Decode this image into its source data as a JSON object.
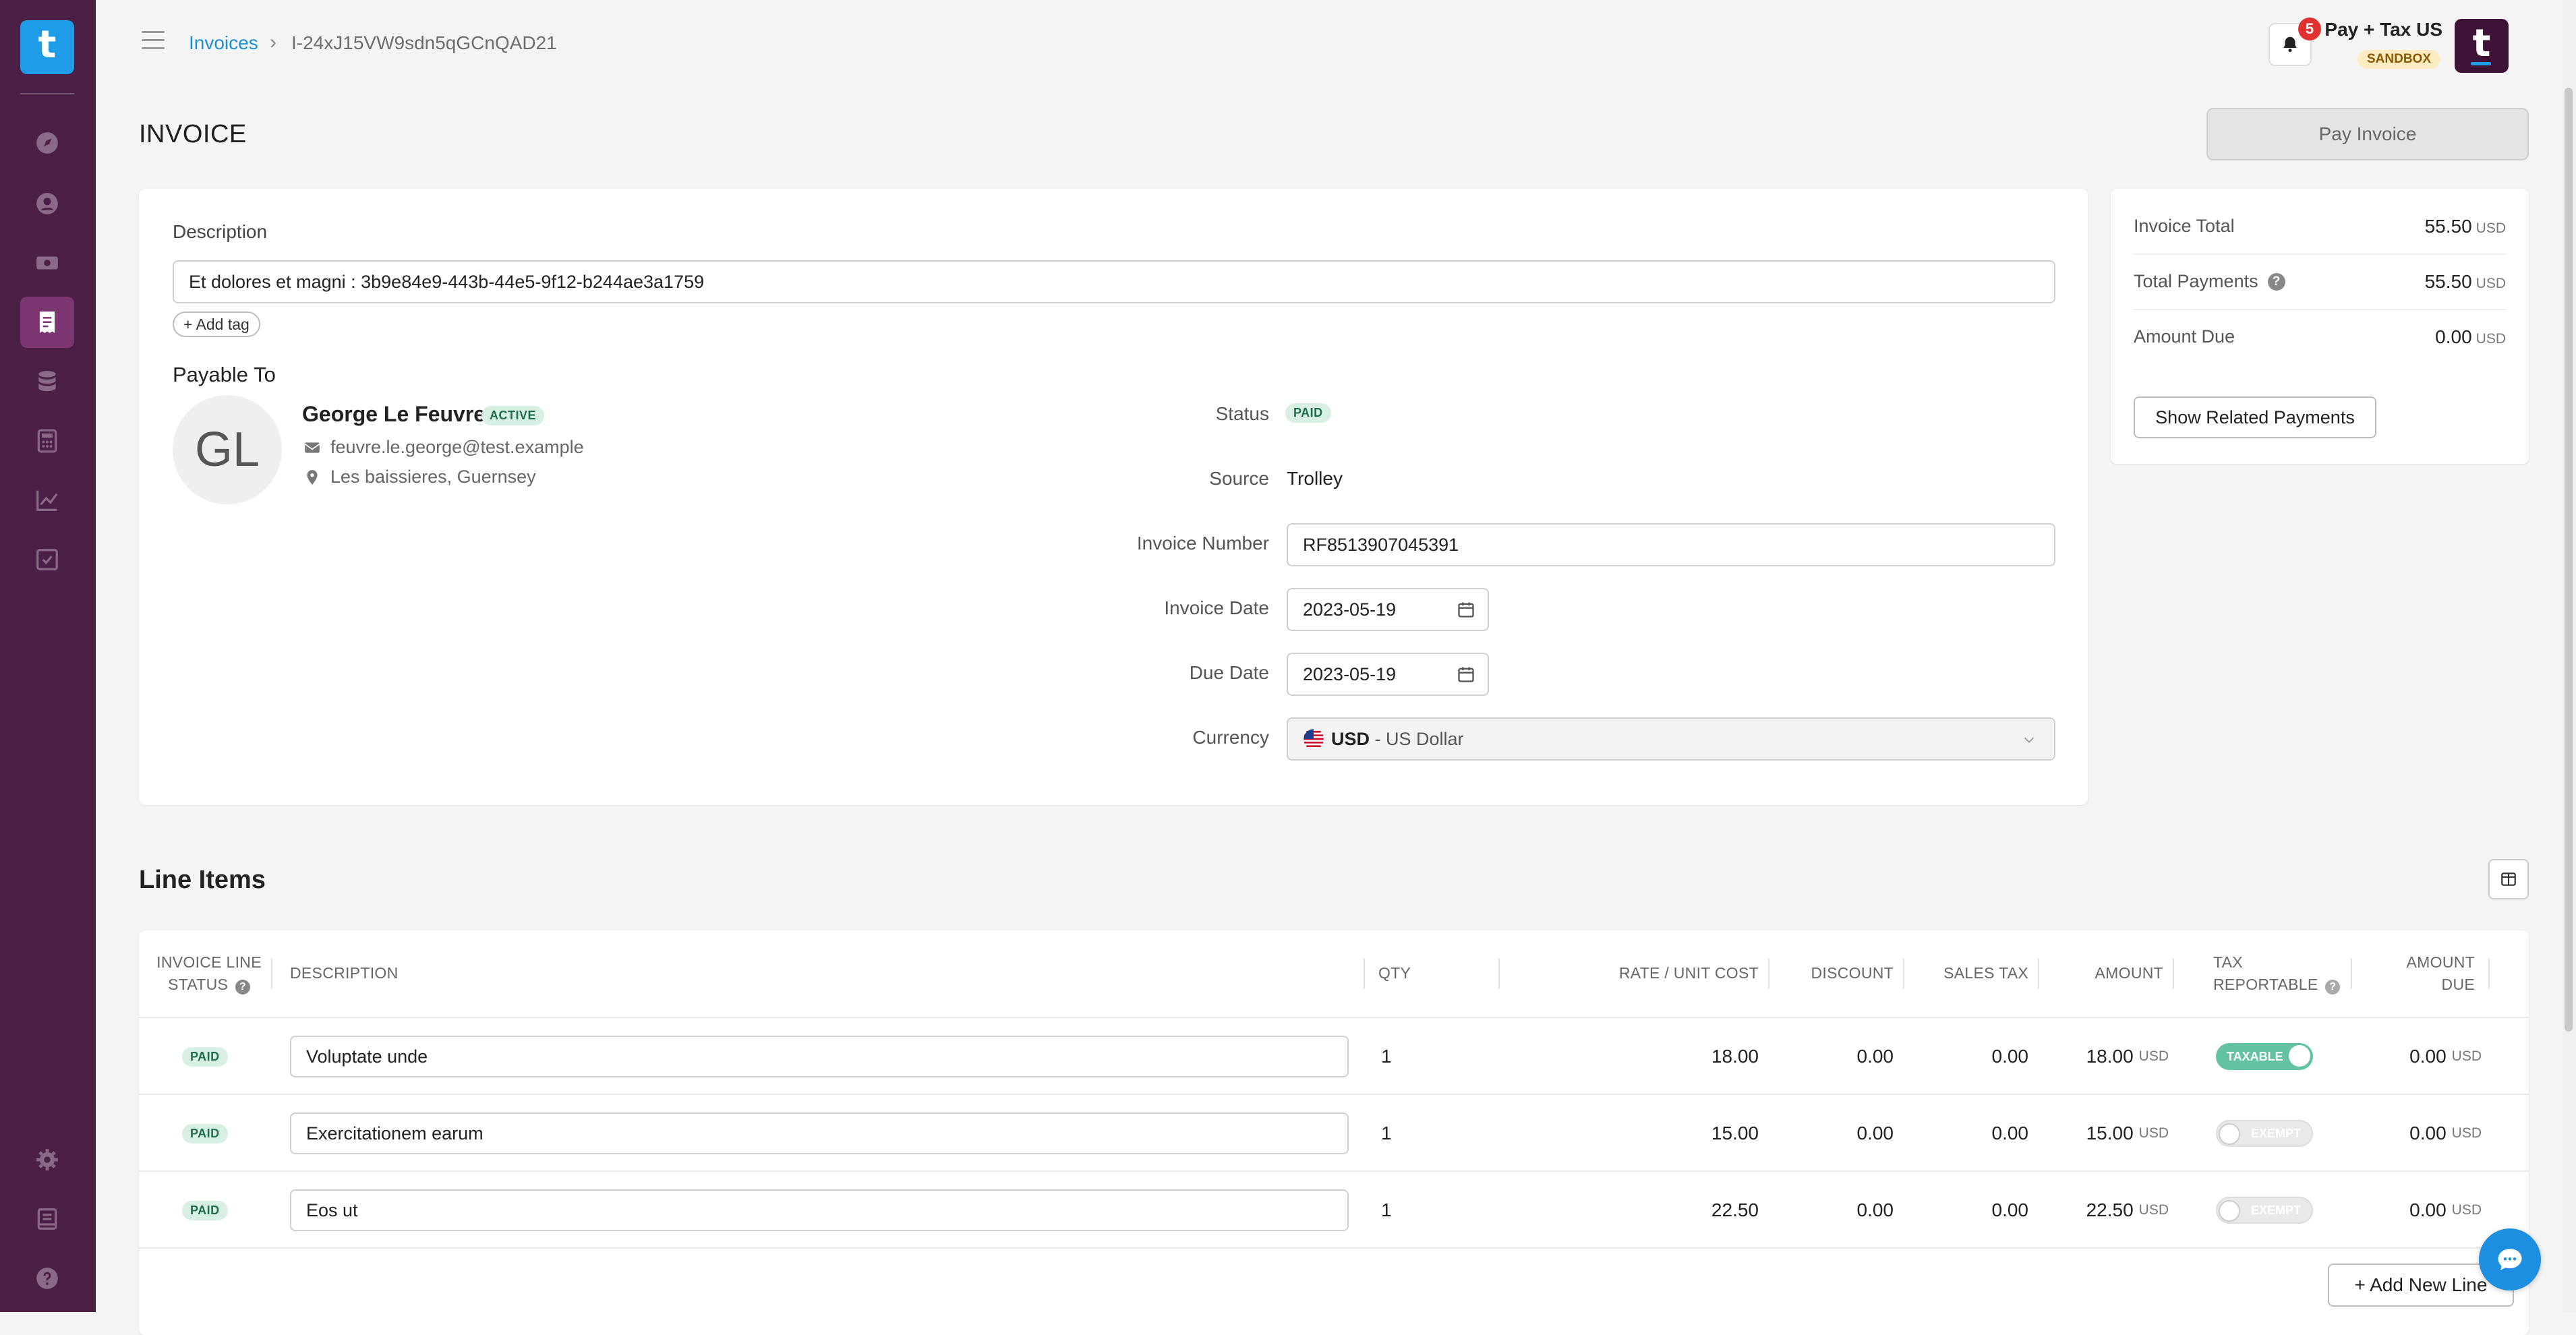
{
  "sidebar": {
    "logo": "t",
    "nav_items": [
      {
        "icon": "dashboard-icon",
        "label": "Dashboard"
      },
      {
        "icon": "person-icon",
        "label": "Recipients"
      },
      {
        "icon": "money-icon",
        "label": "Payments"
      },
      {
        "icon": "invoice-icon",
        "label": "Invoices"
      },
      {
        "icon": "database-icon",
        "label": "Data"
      },
      {
        "icon": "calculator-icon",
        "label": "Tax"
      },
      {
        "icon": "chart-icon",
        "label": "Reports"
      },
      {
        "icon": "checklist-icon",
        "label": "Tasks"
      }
    ],
    "bottom_items": [
      {
        "icon": "gear-icon"
      },
      {
        "icon": "book-icon"
      },
      {
        "icon": "help-icon"
      }
    ]
  },
  "header": {
    "breadcrumb_root": "Invoices",
    "breadcrumb_sep": "›",
    "breadcrumb_current": "I-24xJ15VW9sdn5qGCnQAD21",
    "notification_count": "5",
    "org_name": "Pay + Tax US",
    "env_badge": "SANDBOX",
    "org_logo": "t"
  },
  "page": {
    "title": "INVOICE",
    "pay_button": "Pay Invoice"
  },
  "invoice": {
    "description_label": "Description",
    "description_value": "Et dolores et magni : 3b9e84e9-443b-44e5-9f12-b244ae3a1759",
    "add_tag": "+ Add tag",
    "payable_to_label": "Payable To",
    "payee": {
      "initials": "GL",
      "name": "George Le Feuvre",
      "status": "ACTIVE",
      "email": "feuvre.le.george@test.example",
      "location": "Les baissieres, Guernsey"
    },
    "fields": {
      "status_label": "Status",
      "status_value": "PAID",
      "source_label": "Source",
      "source_value": "Trolley",
      "number_label": "Invoice Number",
      "number_value": "RF8513907045391",
      "invoice_date_label": "Invoice Date",
      "invoice_date_value": "2023-05-19",
      "due_date_label": "Due Date",
      "due_date_value": "2023-05-19",
      "currency_label": "Currency",
      "currency_code": "USD",
      "currency_name": " - US Dollar"
    }
  },
  "summary": {
    "rows": [
      {
        "label": "Invoice Total",
        "value": "55.50",
        "unit": "USD"
      },
      {
        "label": "Total Payments",
        "value": "55.50",
        "unit": "USD"
      },
      {
        "label": "Amount Due",
        "value": "0.00",
        "unit": "USD"
      }
    ],
    "help": "?",
    "related_button": "Show Related Payments"
  },
  "line_items": {
    "title": "Line Items",
    "columns": {
      "status_1": "INVOICE LINE",
      "status_2": "STATUS",
      "description": "DESCRIPTION",
      "qty": "QTY",
      "rate": "RATE / UNIT COST",
      "discount": "DISCOUNT",
      "sales_tax": "SALES TAX",
      "amount": "AMOUNT",
      "tax_1": "TAX",
      "tax_2": "REPORTABLE",
      "due_1": "AMOUNT",
      "due_2": "DUE"
    },
    "rows": [
      {
        "status": "PAID",
        "description": "Voluptate unde",
        "qty": "1",
        "rate": "18.00",
        "discount": "0.00",
        "sales_tax": "0.00",
        "amount": "18.00",
        "unit": "USD",
        "tax": "TAXABLE",
        "tax_on": true,
        "due": "0.00"
      },
      {
        "status": "PAID",
        "description": "Exercitationem earum",
        "qty": "1",
        "rate": "15.00",
        "discount": "0.00",
        "sales_tax": "0.00",
        "amount": "15.00",
        "unit": "USD",
        "tax": "EXEMPT",
        "tax_on": false,
        "due": "0.00"
      },
      {
        "status": "PAID",
        "description": "Eos ut",
        "qty": "1",
        "rate": "22.50",
        "discount": "0.00",
        "sales_tax": "0.00",
        "amount": "22.50",
        "unit": "USD",
        "tax": "EXEMPT",
        "tax_on": false,
        "due": "0.00"
      }
    ],
    "add_button": "+ Add New Line"
  },
  "colors": {
    "sidebar": "#4c2046",
    "accent": "#1d8fd6",
    "paid_badge": "#d8efe4",
    "taxable_toggle": "#63c3a0"
  }
}
